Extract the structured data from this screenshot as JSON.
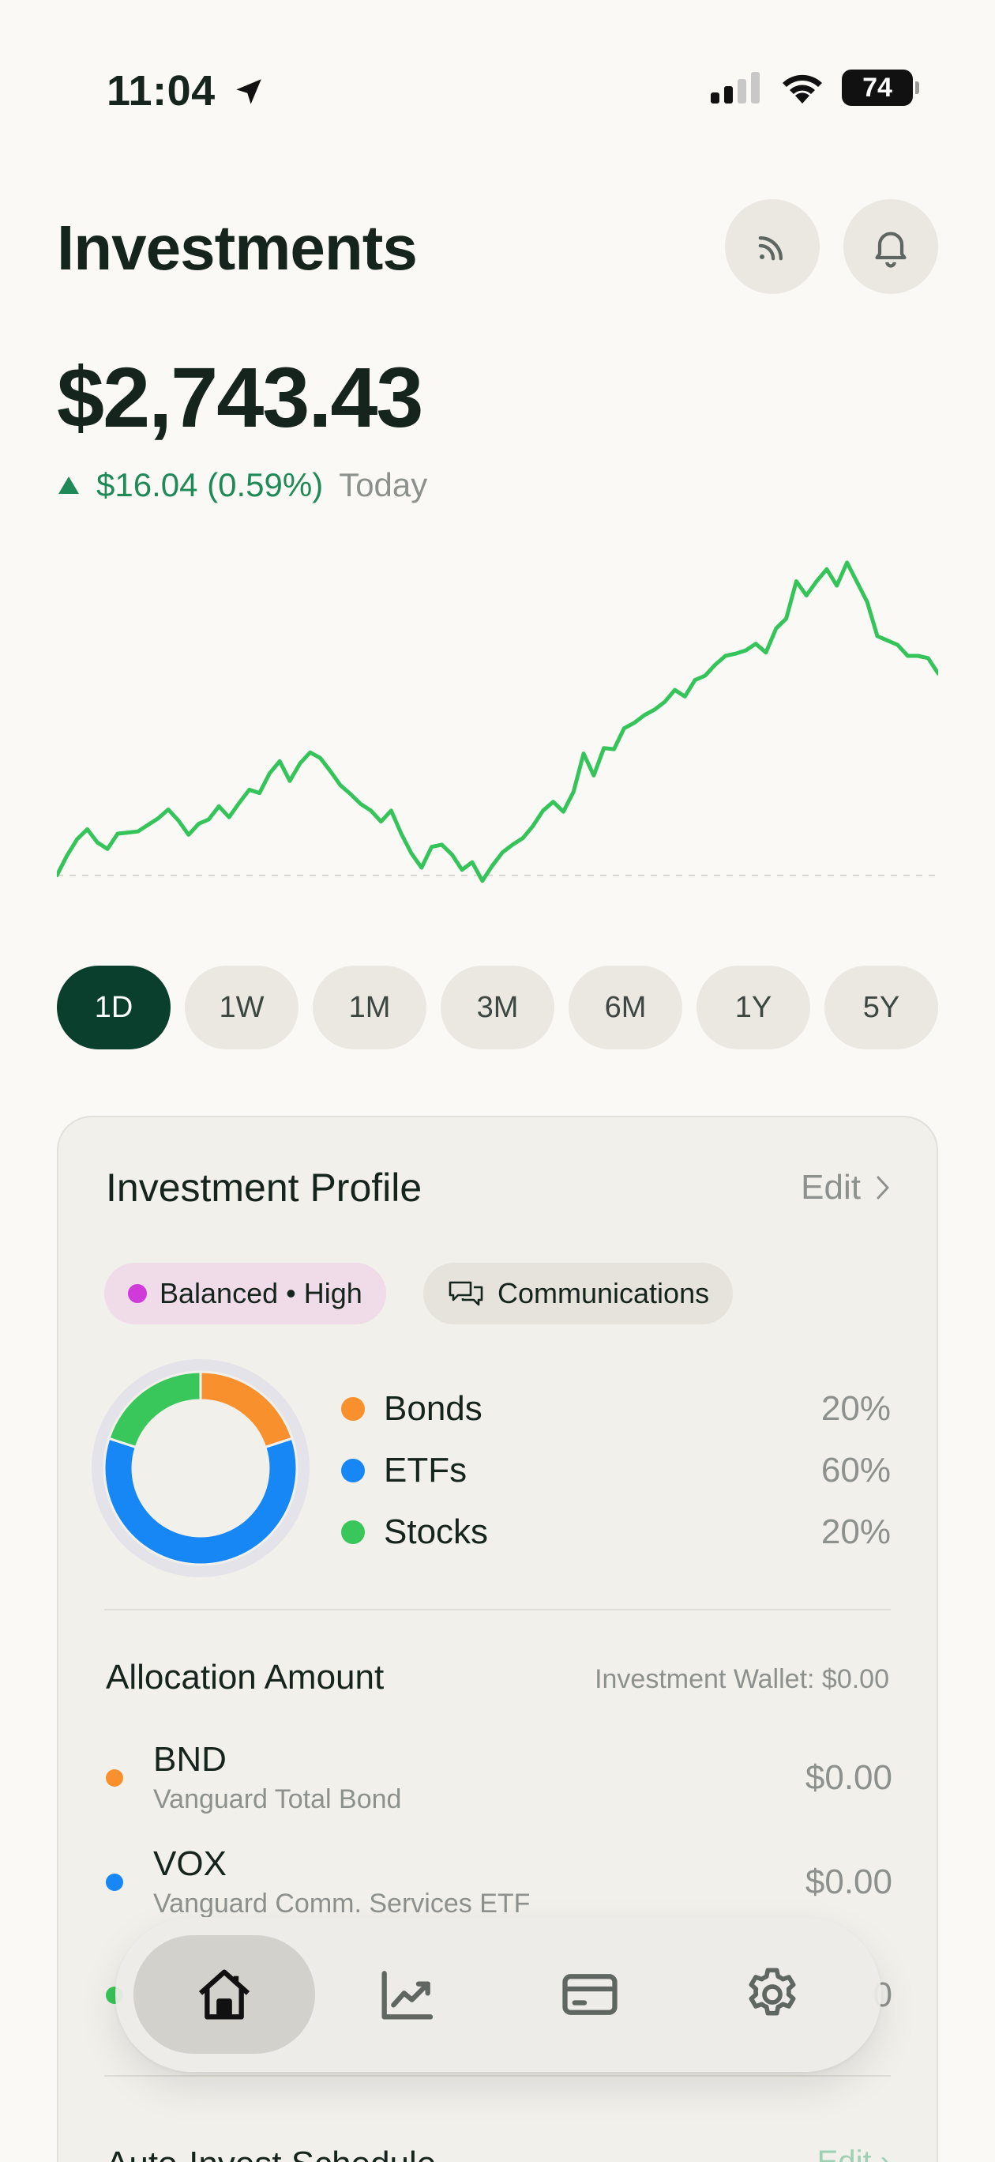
{
  "status_bar": {
    "time": "11:04",
    "battery": "74"
  },
  "header": {
    "title": "Investments",
    "icons": [
      "rss-icon",
      "bell-icon"
    ]
  },
  "portfolio": {
    "balance": "$2,743.43",
    "change": "$16.04 (0.59%)",
    "change_period": "Today",
    "trend": "up",
    "color_positive": "#1f8a58"
  },
  "chart_data": {
    "type": "line",
    "title": "",
    "xlabel": "",
    "ylabel": "",
    "series": [
      {
        "values": [
          2727.2,
          2729.0,
          2730.5,
          2731.4,
          2730.2,
          2729.6,
          2731.0,
          2731.1,
          2731.2,
          2731.8,
          2732.4,
          2733.2,
          2732.2,
          2730.9,
          2731.9,
          2732.3,
          2733.5,
          2732.5,
          2733.8,
          2735.0,
          2734.7,
          2736.5,
          2737.6,
          2735.8,
          2737.4,
          2738.4,
          2737.9,
          2736.7,
          2735.4,
          2734.6,
          2733.7,
          2733.1,
          2732.1,
          2733.1,
          2731.0,
          2729.2,
          2727.9,
          2729.8,
          2730.0,
          2729.1,
          2727.7,
          2728.4,
          2726.7,
          2728.1,
          2729.3,
          2730.0,
          2730.6,
          2731.7,
          2733.1,
          2733.9,
          2733.0,
          2734.8,
          2738.3,
          2736.3,
          2738.8,
          2738.7,
          2740.6,
          2741.1,
          2741.8,
          2742.3,
          2743.0,
          2744.1,
          2743.5,
          2745.0,
          2745.4,
          2746.4,
          2747.2,
          2747.4,
          2747.7,
          2748.3,
          2747.5,
          2749.7,
          2750.6,
          2754.0,
          2752.7,
          2754.0,
          2755.1,
          2753.6,
          2755.7,
          2753.9,
          2752.1,
          2749.0,
          2748.6,
          2748.2,
          2747.2,
          2747.2,
          2747.0,
          2745.6
        ]
      }
    ],
    "baseline": 2727.2,
    "ylim": [
      2722,
      2758
    ],
    "grid": false,
    "ranges": [
      "1D",
      "1W",
      "1M",
      "3M",
      "6M",
      "1Y",
      "5Y"
    ],
    "selected_range": "1D",
    "line_color": "#35c45a"
  },
  "profile": {
    "title": "Investment Profile",
    "edit_label": "Edit",
    "risk_tag": "Balanced • High",
    "risk_color": "#cf3ad9",
    "sector_tag": "Communications",
    "allocation": [
      {
        "name": "Bonds",
        "pct": "20%",
        "value": 20,
        "color": "#f7902d"
      },
      {
        "name": "ETFs",
        "pct": "60%",
        "value": 60,
        "color": "#1787f5"
      },
      {
        "name": "Stocks",
        "pct": "20%",
        "value": 20,
        "color": "#39c65a"
      }
    ]
  },
  "allocation_amount": {
    "title": "Allocation Amount",
    "wallet": "Investment Wallet: $0.00",
    "funds": [
      {
        "ticker": "BND",
        "name": "Vanguard Total Bond",
        "amount": "$0.00",
        "color": "#f7902d"
      },
      {
        "ticker": "VOX",
        "name": "Vanguard Comm. Services ETF",
        "amount": "$0.00",
        "color": "#1787f5"
      },
      {
        "ticker": "",
        "name": "",
        "amount": "0",
        "color": "#39c65a"
      }
    ]
  },
  "schedule": {
    "title": "Auto-Invest Schedule",
    "edit_label": "Edit ›"
  },
  "tabbar": {
    "tabs": [
      "home-icon",
      "chart-icon",
      "card-icon",
      "settings-icon"
    ],
    "active": 0
  }
}
